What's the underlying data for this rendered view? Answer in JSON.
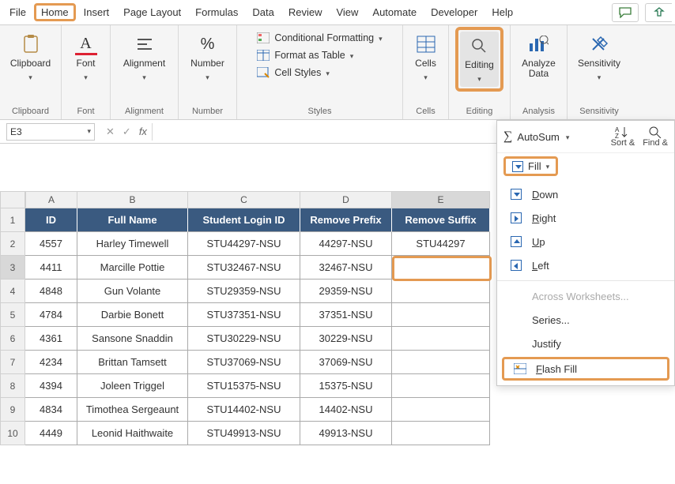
{
  "menu": {
    "items": [
      "File",
      "Home",
      "Insert",
      "Page Layout",
      "Formulas",
      "Data",
      "Review",
      "View",
      "Automate",
      "Developer",
      "Help"
    ],
    "selected": "Home"
  },
  "ribbon": {
    "clipboard": "Clipboard",
    "font": "Font",
    "alignment": "Alignment",
    "number": "Number",
    "styles": {
      "label": "Styles",
      "cond": "Conditional Formatting",
      "table": "Format as Table",
      "cellstyles": "Cell Styles"
    },
    "cells": "Cells",
    "editing": "Editing",
    "analyze": {
      "line1": "Analyze",
      "line2": "Data",
      "group": "Analysis"
    },
    "sensitivity": {
      "label": "Sensitivity",
      "group": "Sensitivity"
    }
  },
  "namebox": "E3",
  "columns": [
    "A",
    "B",
    "C",
    "D",
    "E"
  ],
  "headers": [
    "ID",
    "Full Name",
    "Student Login ID",
    "Remove Prefix",
    "Remove Suffix"
  ],
  "rows": [
    {
      "n": 2,
      "id": "4557",
      "name": "Harley Timewell",
      "login": "STU44297-NSU",
      "pre": "44297-NSU",
      "suf": "STU44297"
    },
    {
      "n": 3,
      "id": "4411",
      "name": "Marcille Pottie",
      "login": "STU32467-NSU",
      "pre": "32467-NSU",
      "suf": ""
    },
    {
      "n": 4,
      "id": "4848",
      "name": "Gun Volante",
      "login": "STU29359-NSU",
      "pre": "29359-NSU",
      "suf": ""
    },
    {
      "n": 5,
      "id": "4784",
      "name": "Darbie Bonett",
      "login": "STU37351-NSU",
      "pre": "37351-NSU",
      "suf": ""
    },
    {
      "n": 6,
      "id": "4361",
      "name": "Sansone Snaddin",
      "login": "STU30229-NSU",
      "pre": "30229-NSU",
      "suf": ""
    },
    {
      "n": 7,
      "id": "4234",
      "name": "Brittan Tamsett",
      "login": "STU37069-NSU",
      "pre": "37069-NSU",
      "suf": ""
    },
    {
      "n": 8,
      "id": "4394",
      "name": "Joleen Triggel",
      "login": "STU15375-NSU",
      "pre": "15375-NSU",
      "suf": ""
    },
    {
      "n": 9,
      "id": "4834",
      "name": "Timothea Sergeaunt",
      "login": "STU14402-NSU",
      "pre": "14402-NSU",
      "suf": ""
    },
    {
      "n": 10,
      "id": "4449",
      "name": "Leonid Haithwaite",
      "login": "STU49913-NSU",
      "pre": "49913-NSU",
      "suf": ""
    }
  ],
  "panel": {
    "autosum": "AutoSum",
    "fill": "Fill",
    "sort": "Sort &",
    "find": "Find &",
    "items": {
      "down": "Down",
      "right": "Right",
      "up": "Up",
      "left": "Left",
      "across": "Across Worksheets...",
      "series": "Series...",
      "justify": "Justify",
      "flash": "Flash Fill"
    }
  }
}
